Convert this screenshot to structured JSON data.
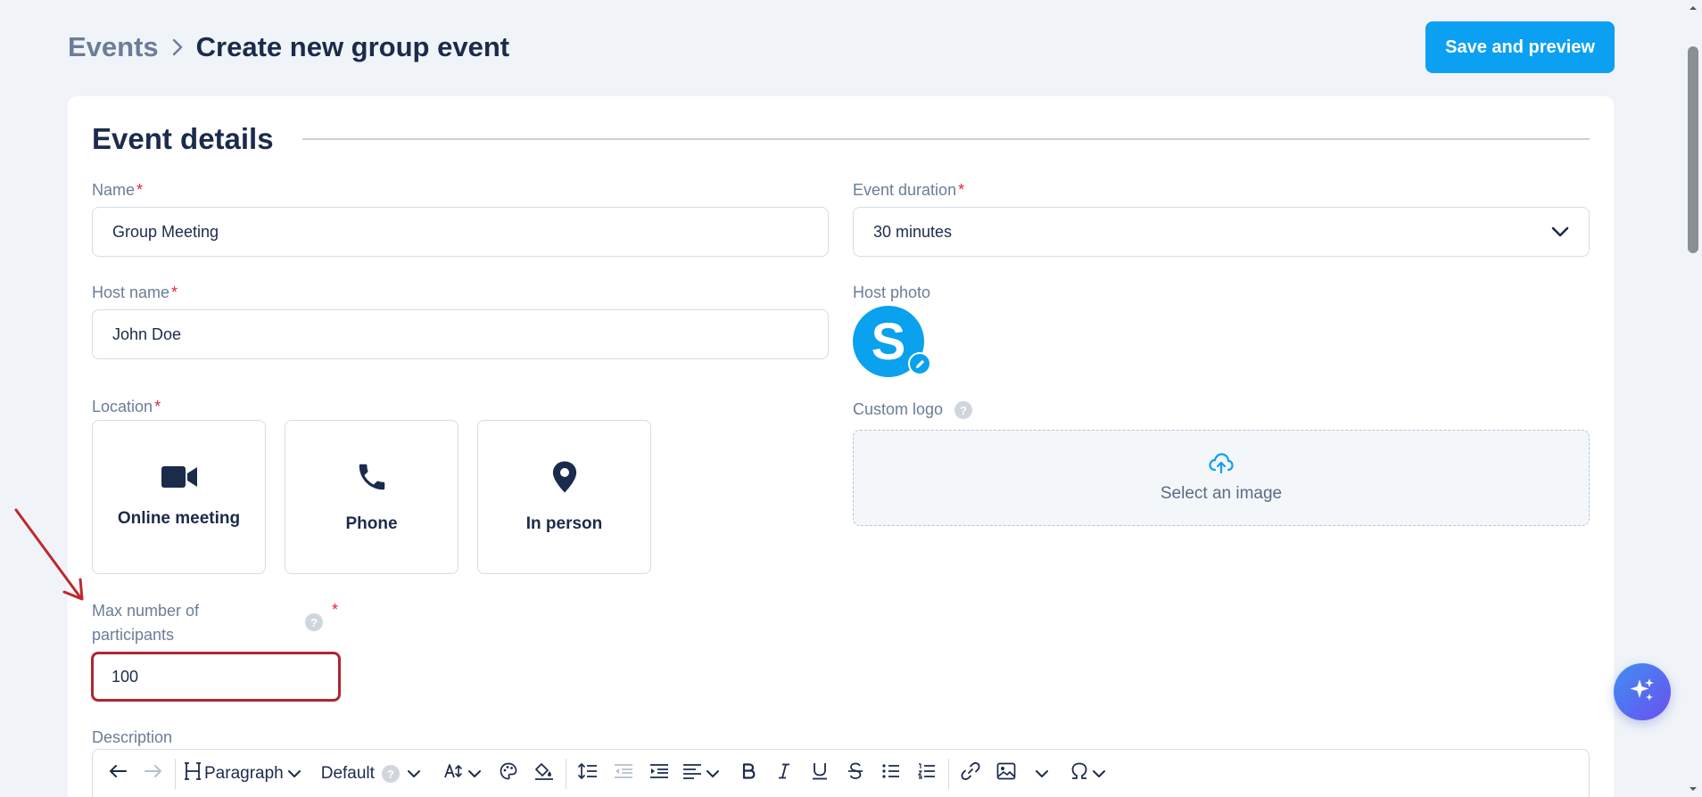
{
  "header": {
    "breadcrumb_root": "Events",
    "breadcrumb_current": "Create new group event",
    "save_preview_label": "Save and preview"
  },
  "section": {
    "title": "Event details"
  },
  "fields": {
    "name": {
      "label": "Name",
      "value": "Group Meeting"
    },
    "event_duration": {
      "label": "Event duration",
      "value": "30 minutes"
    },
    "host_name": {
      "label": "Host name",
      "value": "John Doe"
    },
    "host_photo": {
      "label": "Host photo",
      "initial": "S"
    },
    "location": {
      "label": "Location",
      "options": [
        {
          "label": "Online meeting",
          "icon": "video-camera-icon"
        },
        {
          "label": "Phone",
          "icon": "phone-icon"
        },
        {
          "label": "In person",
          "icon": "map-pin-icon"
        }
      ]
    },
    "custom_logo": {
      "label": "Custom logo",
      "dropzone_text": "Select an image"
    },
    "max_participants": {
      "label_line1": "Max number of",
      "label_line2": "participants",
      "value": "100"
    },
    "description": {
      "label": "Description"
    }
  },
  "help_glyph": "?",
  "required_mark": "*",
  "editor_toolbar": {
    "block_format": "Paragraph",
    "font_family": "Default"
  },
  "colors": {
    "primary": "#0ca0f3",
    "highlight_border": "#b0252f",
    "required": "#e0263a",
    "text_dark": "#1b2b4b",
    "text_muted": "#6b7d97",
    "background": "#f0f4f9"
  }
}
